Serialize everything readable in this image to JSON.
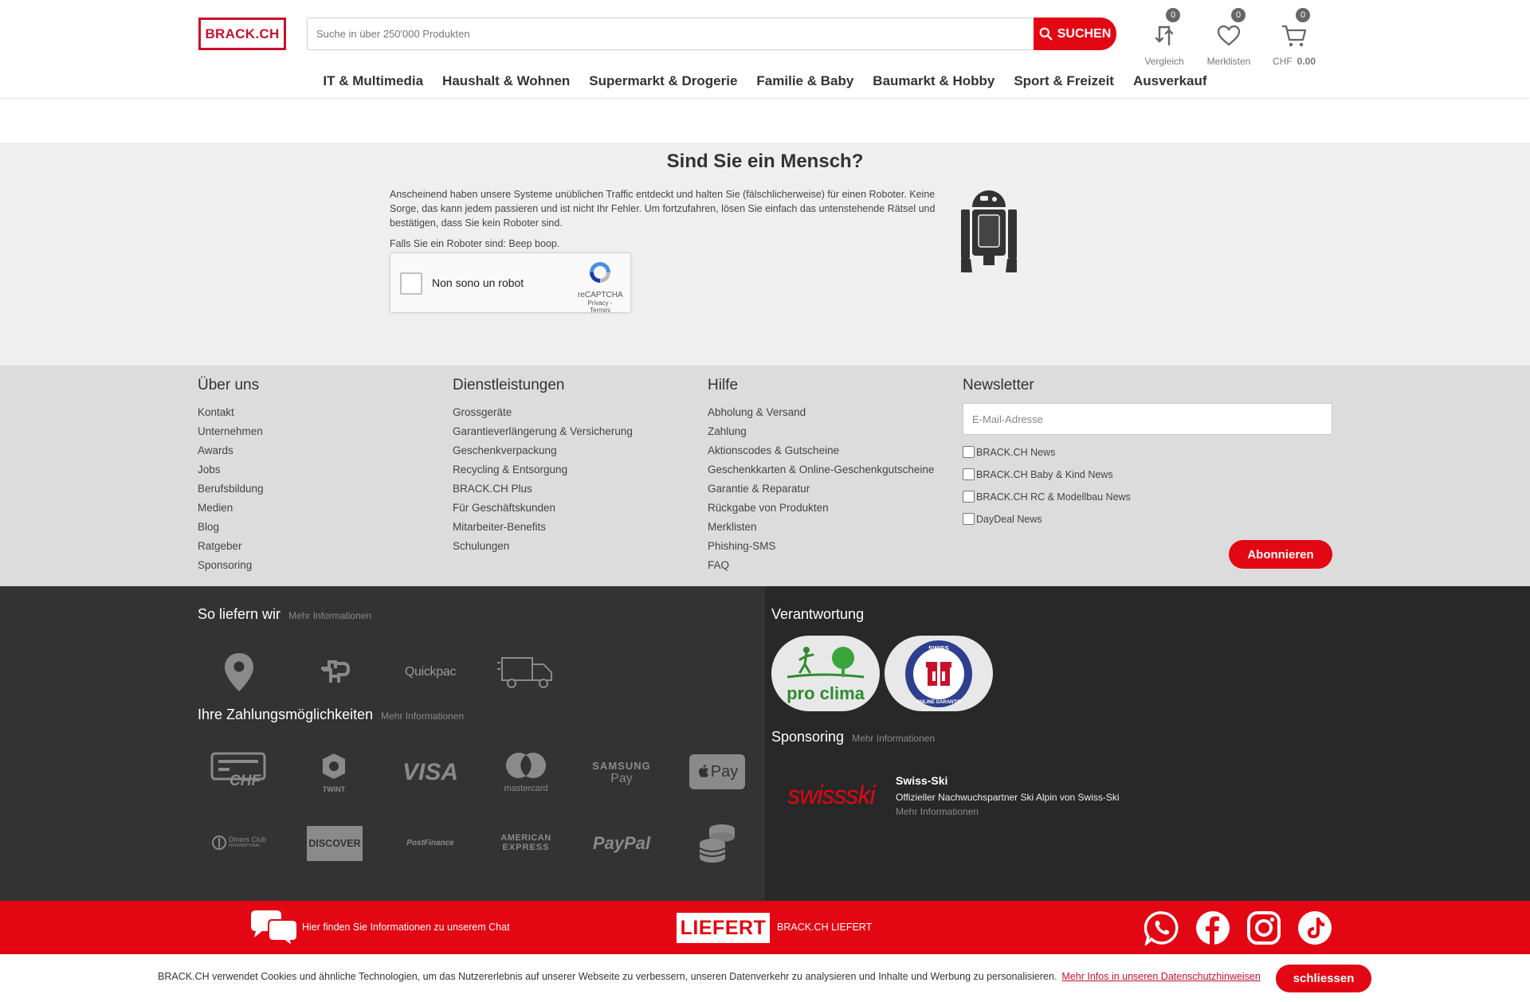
{
  "header": {
    "logo": "BRACK.CH",
    "search_placeholder": "Suche in über 250'000 Produkten",
    "search_button": "SUCHEN",
    "compare": {
      "label": "Vergleich",
      "count": "0"
    },
    "wishlist": {
      "label": "Merklisten",
      "count": "0"
    },
    "cart": {
      "label": "CHF",
      "amount": "0.00",
      "count": "0"
    }
  },
  "nav": {
    "items": [
      "IT & Multimedia",
      "Haushalt & Wohnen",
      "Supermarkt & Drogerie",
      "Familie & Baby",
      "Baumarkt & Hobby",
      "Sport & Freizeit",
      "Ausverkauf"
    ]
  },
  "captcha": {
    "title": "Sind Sie ein Mensch?",
    "text": "Anscheinend haben unsere Systeme unüblichen Traffic entdeckt und halten Sie (fälschlicherweise) für einen Roboter. Keine Sorge, das kann jedem passieren und ist nicht Ihr Fehler. Um fortzufahren, lösen Sie einfach das untenstehende Rätsel und bestätigen, dass Sie kein Roboter sind.",
    "beep": "Falls Sie ein Roboter sind: Beep boop.",
    "recaptcha_label": "Non sono un robot",
    "recaptcha_brand": "reCAPTCHA",
    "recaptcha_links": "Privacy - Termini"
  },
  "footer": {
    "about": {
      "title": "Über uns",
      "links": [
        "Kontakt",
        "Unternehmen",
        "Awards",
        "Jobs",
        "Berufsbildung",
        "Medien",
        "Blog",
        "Ratgeber",
        "Sponsoring"
      ]
    },
    "services": {
      "title": "Dienstleistungen",
      "links": [
        "Grossgeräte",
        "Garantieverlängerung & Versicherung",
        "Geschenkverpackung",
        "Recycling & Entsorgung",
        "BRACK.CH Plus",
        "Für Geschäftskunden",
        "Mitarbeiter-Benefits",
        "Schulungen"
      ]
    },
    "help": {
      "title": "Hilfe",
      "links": [
        "Abholung & Versand",
        "Zahlung",
        "Aktionscodes & Gutscheine",
        "Geschenkkarten & Online-Geschenkgutscheine",
        "Garantie & Reparatur",
        "Rückgabe von Produkten",
        "Merklisten",
        "Phishing-SMS",
        "FAQ"
      ]
    },
    "newsletter": {
      "title": "Newsletter",
      "placeholder": "E-Mail-Adresse",
      "options": [
        "BRACK.CH News",
        "BRACK.CH Baby & Kind News",
        "BRACK.CH RC & Modellbau News",
        "DayDeal News"
      ],
      "button": "Abonnieren"
    }
  },
  "dark": {
    "delivery_title": "So liefern wir",
    "delivery_more": "Mehr Informationen",
    "delivery_icons": [
      "location-pin-icon",
      "post-icon",
      "quickpac-icon",
      "truck-icon"
    ],
    "quickpac": "Quickpac",
    "payment_title": "Ihre Zahlungsmöglichkeiten",
    "payment_more": "Mehr Informationen",
    "payment_icons": [
      "invoice-chf-icon",
      "twint-icon",
      "visa-icon",
      "mastercard-icon",
      "samsung-pay-icon",
      "apple-pay-icon",
      "diners-club-icon",
      "discover-icon",
      "postfinance-icon",
      "american-express-icon",
      "paypal-icon",
      "coins-icon"
    ],
    "pay_labels": {
      "chf": "CHF",
      "twint": "TWINT",
      "visa": "VISA",
      "mastercard": "mastercard",
      "samsung1": "SAMSUNG",
      "samsung2": "Pay",
      "applepay": "Pay",
      "diners1": "Diners Club",
      "diners2": "INTERNATIONAL",
      "discover": "DISCOVER",
      "postfinance": "PostFinance",
      "amex1": "AMERICAN",
      "amex2": "EXPRESS",
      "paypal": "PayPal"
    },
    "responsibility_title": "Verantwortung",
    "proclima": "pro clima",
    "swiss_garantie1": "SWISS",
    "swiss_garantie2": "ONLINE GARANTIE",
    "sponsoring_title": "Sponsoring",
    "sponsoring_more": "Mehr Informationen",
    "sponsor_logo": "swissski",
    "sponsor_name": "Swiss-Ski",
    "sponsor_desc": "Offizieller Nachwuchspartner Ski Alpin von Swiss-Ski",
    "sponsor_more": "Mehr Informationen"
  },
  "redbar": {
    "chat_text": "Hier finden Sie Informationen zu unserem Chat",
    "liefert_logo": "LIEFERT",
    "liefert_text": "BRACK.CH LIEFERT",
    "social_icons": [
      "whatsapp-icon",
      "facebook-icon",
      "instagram-icon",
      "tiktok-icon"
    ]
  },
  "cookie": {
    "text": "BRACK.CH verwendet Cookies und ähnliche Technologien, um das Nutzererlebnis auf unserer Webseite zu verbessern, unseren Datenverkehr zu analysieren und Inhalte und Werbung zu personalisieren.",
    "link": "Mehr Infos in unseren Datenschutzhinweisen",
    "button": "schliessen"
  },
  "colors": {
    "brand_red": "#e30613",
    "dark_left": "#333333",
    "dark_right": "#282828",
    "footer_light": "#dcdcdc",
    "captcha_bg": "#efefef"
  }
}
